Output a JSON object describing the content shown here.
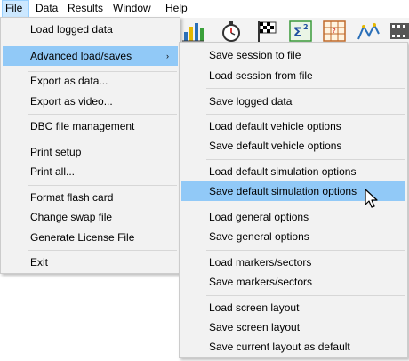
{
  "menubar": {
    "items": [
      "File",
      "Data",
      "Results",
      "Window",
      "Help"
    ]
  },
  "toolbar": {
    "icons": [
      "bar-chart-icon",
      "stopwatch-icon",
      "checkered-flag-icon",
      "sigma-squared-icon",
      "calculator-grid-icon",
      "track-map-icon",
      "filmstrip-icon"
    ]
  },
  "file_menu": {
    "items": [
      "Load logged data",
      "Advanced load/saves",
      "Export as data...",
      "Export as video...",
      "DBC file management",
      "Print setup",
      "Print all...",
      "Format flash card",
      "Change swap file",
      "Generate License File",
      "Exit"
    ],
    "submenu_arrow": "›"
  },
  "submenu": {
    "items": [
      "Save session to file",
      "Load session from file",
      "Save logged data",
      "Load default vehicle options",
      "Save default vehicle options",
      "Load default simulation options",
      "Save default simulation options",
      "Load general options",
      "Save general options",
      "Load markers/sectors",
      "Save markers/sectors",
      "Load screen layout",
      "Save screen layout",
      "Save current layout as default"
    ],
    "highlighted": "Save default simulation options"
  },
  "colors": {
    "highlight": "#91c9f7",
    "menubar_active": "#cce8ff",
    "menu_bg": "#f2f2f2"
  }
}
